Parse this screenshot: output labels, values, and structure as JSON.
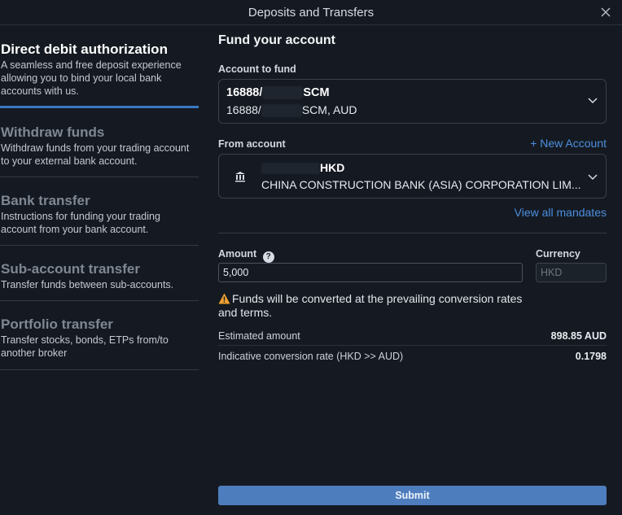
{
  "window": {
    "title": "Deposits and Transfers"
  },
  "sidebar": {
    "items": [
      {
        "title": "Direct debit authorization",
        "desc": "A seamless and free deposit experience allowing you to bind your local bank accounts with us."
      },
      {
        "title": "Withdraw funds",
        "desc": "Withdraw funds from your trading account to your external bank account."
      },
      {
        "title": "Bank transfer",
        "desc": "Instructions for funding your trading account from your bank account."
      },
      {
        "title": "Sub-account transfer",
        "desc": "Transfer funds between sub-accounts."
      },
      {
        "title": "Portfolio transfer",
        "desc": "Transfer stocks, bonds, ETPs from/to another broker"
      }
    ]
  },
  "main": {
    "title": "Fund your account",
    "account_to_fund": {
      "label": "Account to fund",
      "line1_prefix": "16888/",
      "line1_suffix": "SCM",
      "line2_prefix": "16888/",
      "line2_suffix": "SCM, AUD"
    },
    "from_account": {
      "label": "From account",
      "new_account_link": "+ New Account",
      "currency": "HKD",
      "bank_name": "CHINA CONSTRUCTION BANK (ASIA) CORPORATION LIM...",
      "view_mandates_link": "View all mandates"
    },
    "amount": {
      "label": "Amount",
      "value": "5,000"
    },
    "currency": {
      "label": "Currency",
      "placeholder": "HKD"
    },
    "warning": "Funds will be converted at the prevailing conversion rates and terms.",
    "estimated": {
      "label": "Estimated amount",
      "value": "898.85 AUD"
    },
    "rate": {
      "label": "Indicative conversion rate (HKD >> AUD)",
      "value": "0.1798"
    },
    "submit_label": "Submit"
  },
  "colors": {
    "accent": "#4c8fde",
    "submit": "#4d7dbd",
    "warning": "#f0a030",
    "background": "#151a22"
  },
  "icons": [
    "close-icon",
    "chevron-down-icon",
    "bank-icon",
    "help-icon",
    "warning-icon"
  ]
}
